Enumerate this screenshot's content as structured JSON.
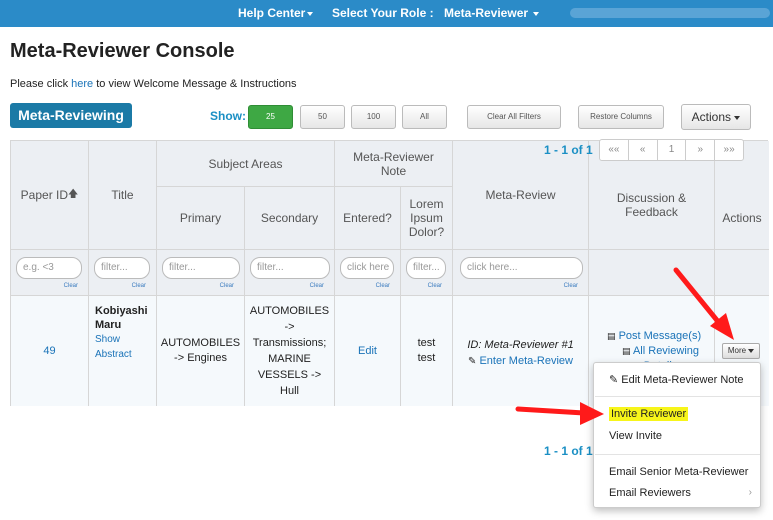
{
  "topbar": {
    "help_center": "Help Center",
    "select_role": "Select Your Role :",
    "role": "Meta-Reviewer"
  },
  "page": {
    "title": "Meta-Reviewer Console",
    "welcome_prefix": "Please click ",
    "welcome_link": "here",
    "welcome_suffix": " to view Welcome Message & Instructions"
  },
  "toolbar": {
    "badge": "Meta-Reviewing",
    "show_label": "Show:",
    "page_sizes": [
      "25",
      "50",
      "100",
      "All"
    ],
    "active_page_size": "25",
    "clear_filters": "Clear All Filters",
    "restore_columns": "Restore Columns",
    "actions": "Actions"
  },
  "pagination": {
    "range_top": "1 - 1 of 1",
    "range_bottom": "1 - 1 of 1",
    "buttons": [
      "««",
      "«",
      "1",
      "»",
      "»»"
    ]
  },
  "table": {
    "headers": {
      "paper_id": "Paper ID",
      "title": "Title",
      "subject_areas": "Subject Areas",
      "primary": "Primary",
      "secondary": "Secondary",
      "note": "Meta-Reviewer Note",
      "entered": "Entered?",
      "lorem": "Lorem Ipsum Dolor?",
      "meta_review": "Meta-Review",
      "discussion": "Discussion & Feedback",
      "actions": "Actions"
    },
    "filters": {
      "paper_id": "e.g. <3",
      "title": "filter...",
      "primary": "filter...",
      "secondary": "filter...",
      "entered": "click here",
      "lorem": "filter...",
      "meta_review": "click here...",
      "clear": "Clear"
    },
    "row": {
      "paper_id": "49",
      "title": "Kobiyashi Maru",
      "show_abstract": "Show Abstract",
      "primary": "AUTOMOBILES -> Engines",
      "secondary": "AUTOMOBILES -> Transmissions; MARINE VESSELS -> Hull",
      "entered": "Edit",
      "lorem": "test test",
      "meta_review_id": "ID: Meta-Reviewer #1",
      "enter_meta_review": "Enter Meta-Review",
      "post_message": "Post Message(s)",
      "all_reviewing_details": "All Reviewing Details",
      "more": "More"
    }
  },
  "menu": {
    "edit_note": "Edit Meta-Reviewer Note",
    "invite_reviewer": "Invite Reviewer",
    "view_invite": "View Invite",
    "email_senior": "Email Senior Meta-Reviewer",
    "email_reviewers": "Email Reviewers"
  },
  "colors": {
    "topbar": "#2b8bc8",
    "badge": "#1b7aa6",
    "active_button": "#3ea844",
    "highlight": "#f7f51a",
    "arrow": "#ff1a1a"
  }
}
